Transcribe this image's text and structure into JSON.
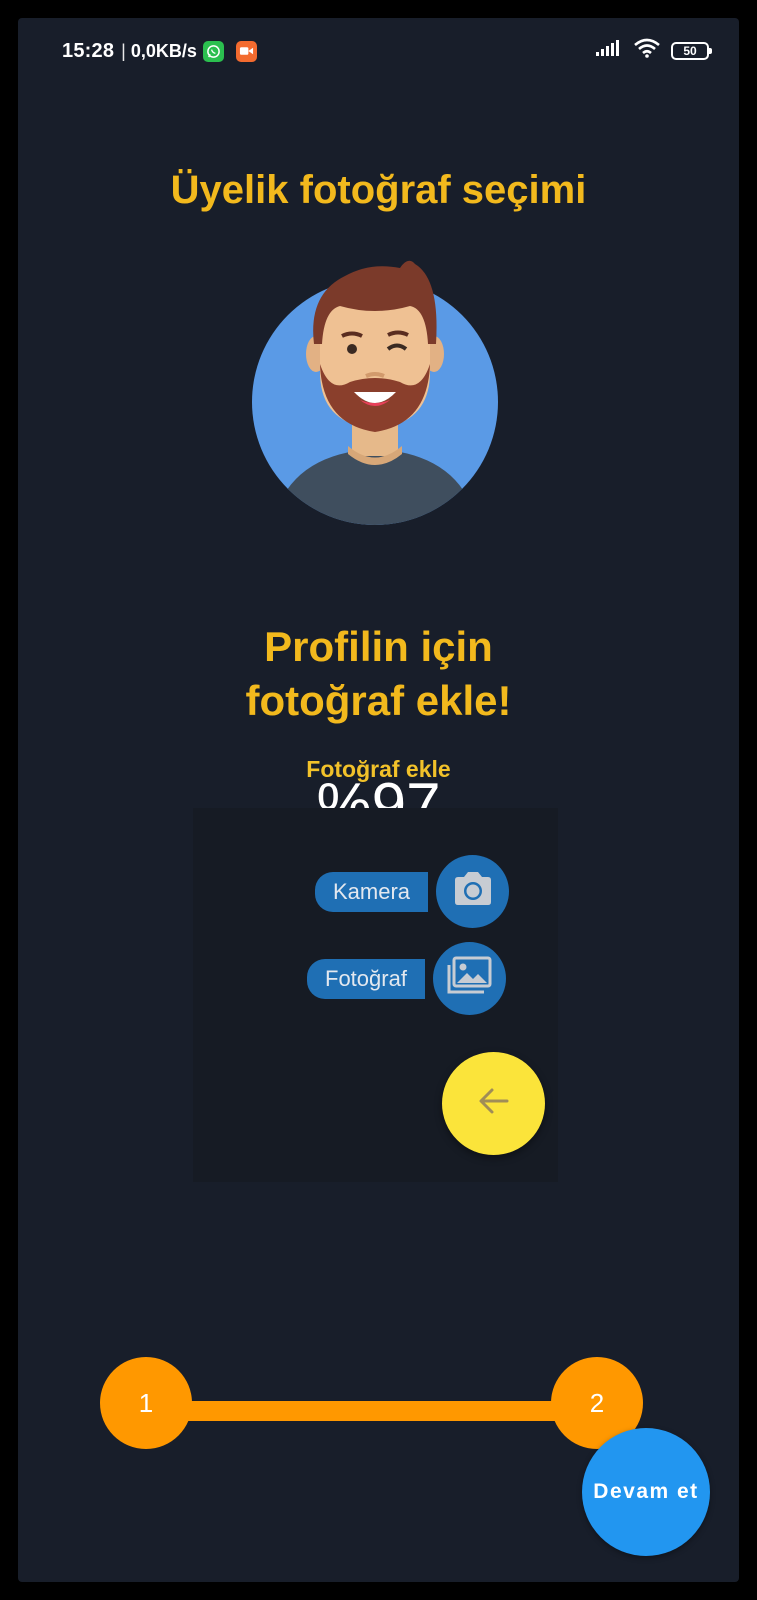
{
  "status_bar": {
    "time": "15:28",
    "separator": "|",
    "network_speed": "0,0KB/s",
    "battery_level": "50",
    "icons": [
      "whatsapp-icon",
      "video-call-icon",
      "signal-icon",
      "wifi-icon",
      "battery-icon"
    ]
  },
  "page": {
    "title": "Üyelik fotoğraf seçimi",
    "subtitle_line1": "Profilin için",
    "subtitle_line2": "fotoğraf ekle!",
    "add_photo_label": "Fotoğraf ekle",
    "progress_text": "%97"
  },
  "fab_menu": {
    "camera_label": "Kamera",
    "gallery_label": "Fotoğraf",
    "camera_icon": "camera-icon",
    "gallery_icon": "gallery-icon",
    "main_icon": "arrow-left-icon"
  },
  "stepper": {
    "steps": [
      {
        "label": "1"
      },
      {
        "label": "2"
      }
    ]
  },
  "next_button": {
    "label": "Devam et"
  },
  "colors": {
    "background": "#181e2a",
    "accent_yellow": "#f2b91d",
    "step_orange": "#ff9800",
    "fab_blue": "#1f6fb4",
    "next_blue": "#2296f0",
    "main_fab_yellow": "#fbe43a"
  }
}
